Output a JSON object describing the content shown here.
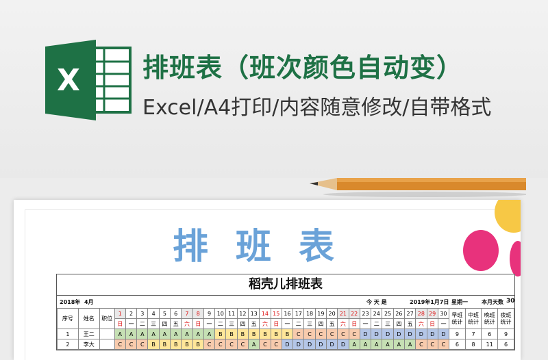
{
  "app": {
    "icon": "excel-icon"
  },
  "header": {
    "title": "排班表（班次颜色自动变）",
    "subtitle": "Excel/A4打印/内容随意修改/自带格式"
  },
  "colors": {
    "excel_green": "#1e7145",
    "title_blue": "#6aa2d8",
    "shift_A": "#c6e0b4",
    "shift_B": "#ffe699",
    "shift_C": "#f8cbad",
    "shift_D": "#b4c6e7"
  },
  "document": {
    "big_title": "排班表",
    "sheet_title": "稻壳儿排班表",
    "year": "2018年",
    "month": "4月",
    "today_label": "今 天 是",
    "today_value": "2019年1月7日",
    "weekday": "星期一",
    "month_days_label": "本月天数",
    "month_days_value": "30",
    "columns": {
      "no": "序号",
      "name": "姓名",
      "role": "职位"
    },
    "days": [
      "1",
      "2",
      "3",
      "4",
      "5",
      "6",
      "7",
      "8",
      "9",
      "10",
      "11",
      "12",
      "13",
      "14",
      "15",
      "16",
      "17",
      "18",
      "19",
      "20",
      "21",
      "22",
      "23",
      "24",
      "25",
      "26",
      "27",
      "28",
      "29",
      "30"
    ],
    "weekdays": [
      "日",
      "一",
      "二",
      "三",
      "四",
      "五",
      "六",
      "日",
      "一",
      "二",
      "三",
      "四",
      "五",
      "六",
      "日",
      "一",
      "二",
      "三",
      "四",
      "五",
      "六",
      "日",
      "一",
      "二",
      "三",
      "四",
      "五",
      "六",
      "日",
      "一"
    ],
    "red_day_indices": [
      0,
      6,
      7,
      13,
      14,
      20,
      21,
      27,
      28
    ],
    "shade_day_indices": [
      0,
      6,
      7,
      20,
      21,
      27,
      28
    ],
    "stats": [
      {
        "l1": "早班",
        "l2": "统计"
      },
      {
        "l1": "中班",
        "l2": "统计"
      },
      {
        "l1": "晚班",
        "l2": "统计"
      },
      {
        "l1": "夜班",
        "l2": "统计"
      }
    ],
    "rows": [
      {
        "no": "1",
        "name": "王二",
        "role": "",
        "shifts": [
          "A",
          "A",
          "A",
          "A",
          "A",
          "A",
          "A",
          "A",
          "A",
          "B",
          "B",
          "B",
          "B",
          "B",
          "B",
          "B",
          "C",
          "C",
          "C",
          "C",
          "C",
          "C",
          "D",
          "D",
          "D",
          "D",
          "D",
          "D",
          "D",
          "D"
        ],
        "stats": [
          "9",
          "7",
          "6",
          "9"
        ]
      },
      {
        "no": "2",
        "name": "李大",
        "role": "",
        "shifts": [
          "C",
          "C",
          "C",
          "B",
          "B",
          "B",
          "B",
          "B",
          "C",
          "C",
          "C",
          "C",
          "A",
          "C",
          "C",
          "D",
          "D",
          "D",
          "D",
          "D",
          "D",
          "A",
          "A",
          "A",
          "A",
          "A",
          "A",
          "C",
          "C",
          "C"
        ],
        "stats": [
          "6",
          "8",
          "11",
          "6"
        ]
      }
    ]
  }
}
